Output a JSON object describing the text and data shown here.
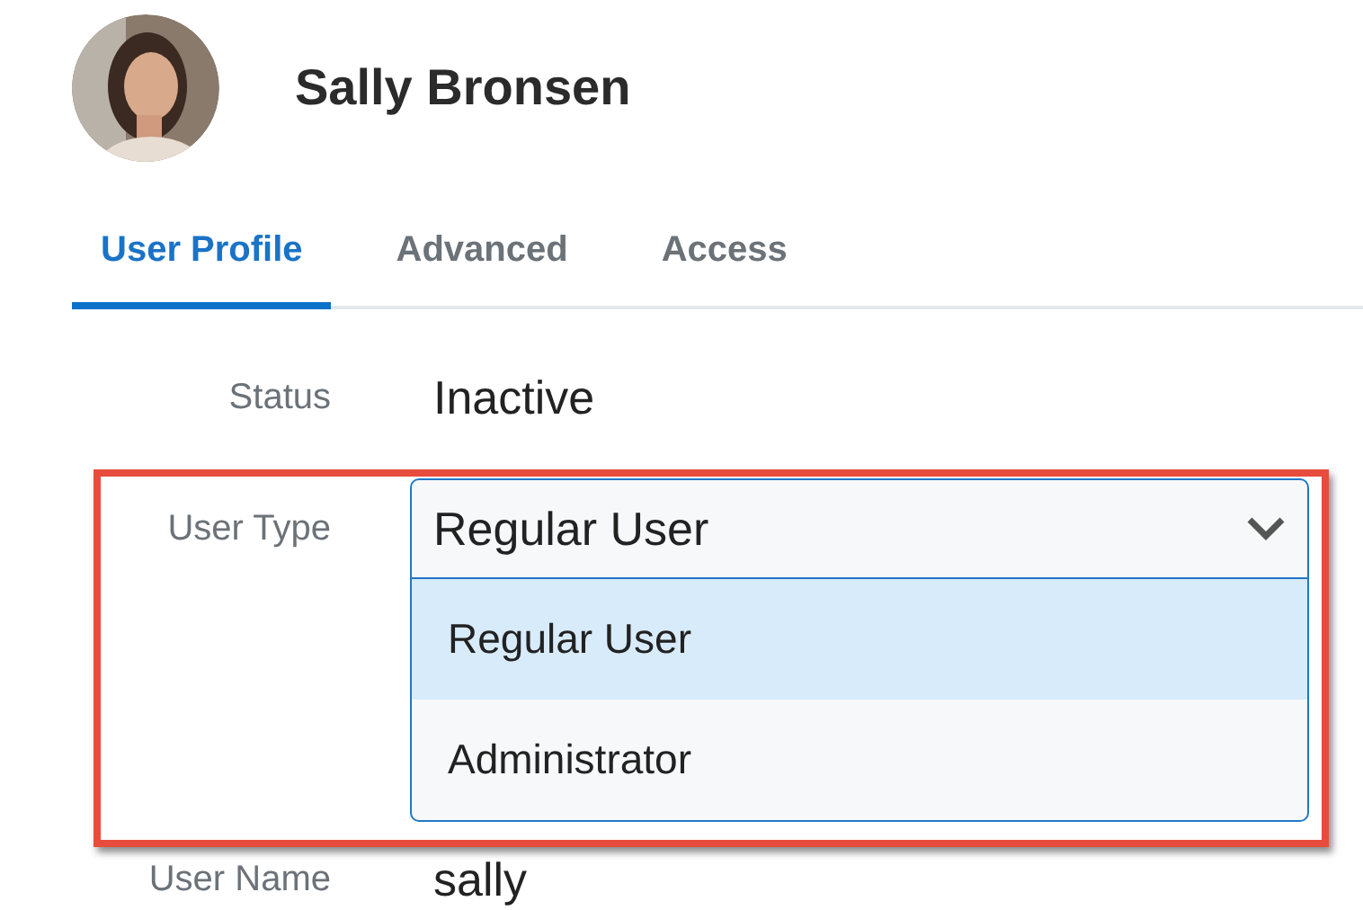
{
  "user": {
    "name": "Sally Bronsen"
  },
  "tabs": [
    {
      "label": "User Profile",
      "selected": true
    },
    {
      "label": "Advanced",
      "selected": false
    },
    {
      "label": "Access",
      "selected": false
    }
  ],
  "fields": [
    {
      "kind": "text",
      "label": "Status",
      "value": "Inactive"
    },
    {
      "kind": "select",
      "label": "User Type",
      "value": "Regular User",
      "expanded": true,
      "options": [
        {
          "label": "Regular User",
          "selected": true
        },
        {
          "label": "Administrator",
          "selected": false
        }
      ]
    },
    {
      "kind": "text",
      "label": "User Name",
      "value": "sally"
    }
  ]
}
